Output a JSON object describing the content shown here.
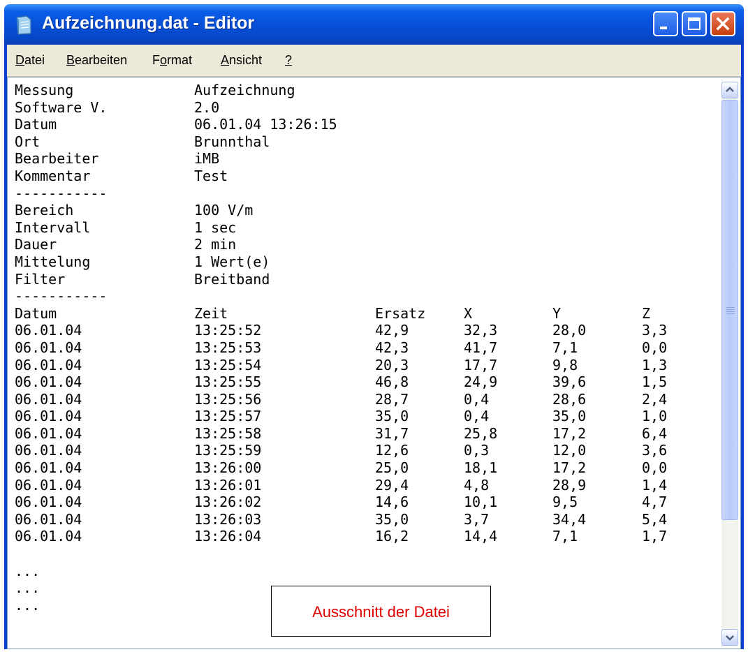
{
  "window": {
    "title": "Aufzeichnung.dat - Editor"
  },
  "menu": [
    "Datei",
    "Bearbeiten",
    "Format",
    "Ansicht",
    "?"
  ],
  "header_fields": [
    {
      "key": "Messung",
      "value": "Aufzeichnung"
    },
    {
      "key": "Software V.",
      "value": "2.0"
    },
    {
      "key": "Datum",
      "value": "06.01.04 13:26:15"
    },
    {
      "key": "Ort",
      "value": "Brunnthal"
    },
    {
      "key": "Bearbeiter",
      "value": "iMB"
    },
    {
      "key": "Kommentar",
      "value": "Test"
    }
  ],
  "separator": "-----------",
  "settings_fields": [
    {
      "key": "Bereich",
      "value": "100 V/m"
    },
    {
      "key": "Intervall",
      "value": "1 sec"
    },
    {
      "key": "Dauer",
      "value": "2 min"
    },
    {
      "key": "Mittelung",
      "value": "1 Wert(e)"
    },
    {
      "key": "Filter",
      "value": "Breitband"
    }
  ],
  "table": {
    "columns": [
      "Datum",
      "Zeit",
      "Ersatz",
      "X",
      "Y",
      "Z"
    ],
    "rows": [
      [
        "06.01.04",
        "13:25:52",
        "42,9",
        "32,3",
        "28,0",
        "3,3"
      ],
      [
        "06.01.04",
        "13:25:53",
        "42,3",
        "41,7",
        "7,1",
        "0,0"
      ],
      [
        "06.01.04",
        "13:25:54",
        "20,3",
        "17,7",
        "9,8",
        "1,3"
      ],
      [
        "06.01.04",
        "13:25:55",
        "46,8",
        "24,9",
        "39,6",
        "1,5"
      ],
      [
        "06.01.04",
        "13:25:56",
        "28,7",
        "0,4",
        "28,6",
        "2,4"
      ],
      [
        "06.01.04",
        "13:25:57",
        "35,0",
        "0,4",
        "35,0",
        "1,0"
      ],
      [
        "06.01.04",
        "13:25:58",
        "31,7",
        "25,8",
        "17,2",
        "6,4"
      ],
      [
        "06.01.04",
        "13:25:59",
        "12,6",
        "0,3",
        "12,0",
        "3,6"
      ],
      [
        "06.01.04",
        "13:26:00",
        "25,0",
        "18,1",
        "17,2",
        "0,0"
      ],
      [
        "06.01.04",
        "13:26:01",
        "29,4",
        "4,8",
        "28,9",
        "1,4"
      ],
      [
        "06.01.04",
        "13:26:02",
        "14,6",
        "10,1",
        "9,5",
        "4,7"
      ],
      [
        "06.01.04",
        "13:26:03",
        "35,0",
        "3,7",
        "34,4",
        "5,4"
      ],
      [
        "06.01.04",
        "13:26:04",
        "16,2",
        "14,4",
        "7,1",
        "1,7"
      ]
    ]
  },
  "ellipsis": [
    "...",
    "...",
    "..."
  ],
  "annotation": "Ausschnitt der Datei",
  "icons": {
    "app": "notepad-icon",
    "minimize": "minimize-icon",
    "maximize": "maximize-icon",
    "close": "close-icon",
    "scroll_up": "chevron-up-icon",
    "scroll_down": "chevron-down-icon"
  },
  "colors": {
    "titlebar": "#0750d8",
    "close_button": "#c8400f",
    "annotation_text": "#e00000"
  }
}
